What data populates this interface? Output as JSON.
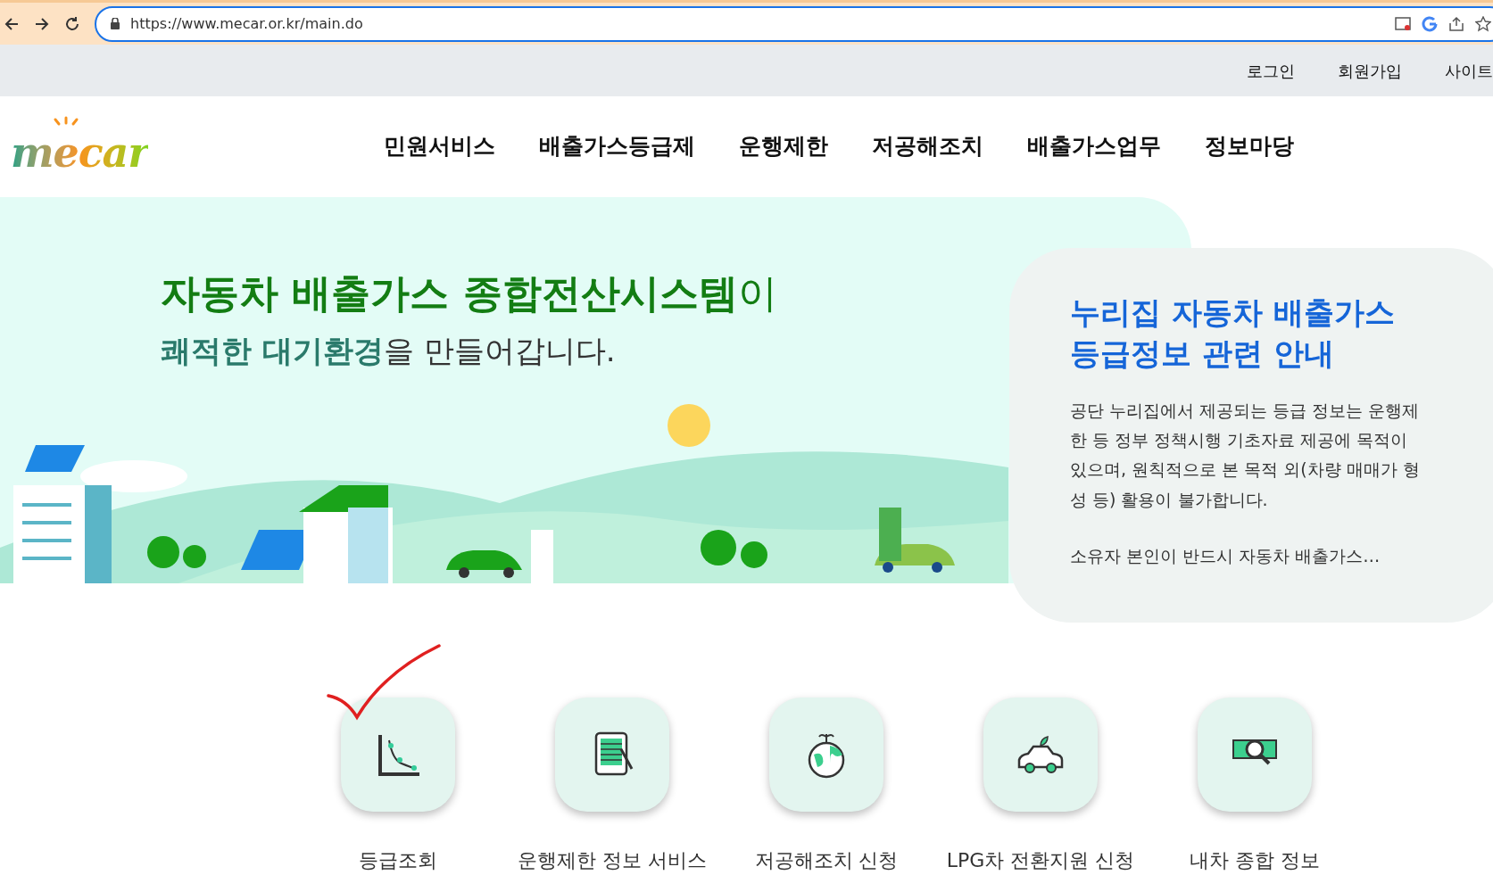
{
  "browser": {
    "url": "https://www.mecar.or.kr/main.do"
  },
  "utility_links": [
    "로그인",
    "회원가입",
    "사이트"
  ],
  "logo": "mecar",
  "nav": [
    "민원서비스",
    "배출가스등급제",
    "운행제한",
    "저공해조치",
    "배출가스업무",
    "정보마당"
  ],
  "hero": {
    "title": "**자동차 배출가스 종합전산시스템**이",
    "subtitle": "**쾌적한 대기환경**을 만들어갑니다."
  },
  "notice": {
    "title": "누리집 자동차 배출가스 등급정보 관련 안내",
    "body": "공단 누리집에서 제공되는 등급 정보는 운행제한 등 정부 정책시행 기초자료 제공에 목적이 있으며, 원칙적으로 본 목적 외(차량 매매가 형성 등) 활용이 불가합니다.",
    "more": "소유자 본인이 반드시 자동차 배출가스…"
  },
  "quick_links": [
    {
      "kind": "chart",
      "label": "등급조회",
      "marked": true
    },
    {
      "kind": "tablet",
      "label": "운행제한 정보 서비스",
      "marked": false
    },
    {
      "kind": "globe",
      "label": "저공해조치 신청",
      "marked": false
    },
    {
      "kind": "car",
      "label": "LPG차 전환지원 신청",
      "marked": false
    },
    {
      "kind": "search",
      "label": "내차 종합 정보",
      "marked": false
    }
  ]
}
